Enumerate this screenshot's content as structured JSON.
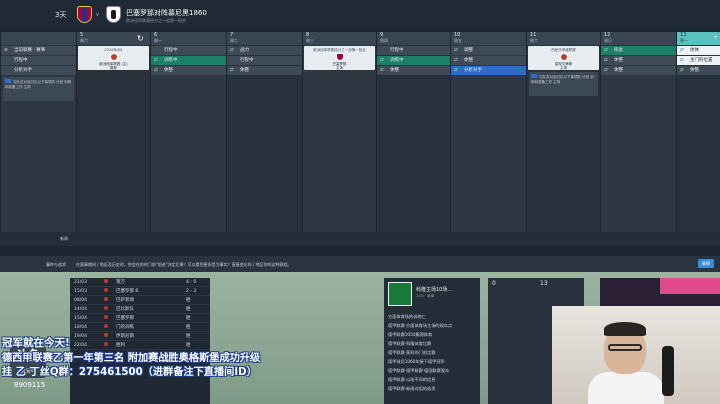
{
  "header": {
    "days": "3天",
    "vs": "v",
    "match_title": "巴塞罗那对阵慕尼黑1860",
    "match_sub": "欧洲冠军联赛经分之一战第一回合"
  },
  "calendar": {
    "columns": [
      {
        "day": "",
        "weekday": "",
        "rows": [
          {
            "icon": "⊕",
            "text": "当前联赛 · 赛事",
            "style": "plain"
          },
          {
            "icon": "",
            "text": "行程中",
            "style": "plain"
          },
          {
            "icon": "",
            "text": "分析对手",
            "style": "plain"
          }
        ],
        "note": "与队友对话讨论以下事项的 计划 训练和准备工作 主场"
      },
      {
        "day": "5",
        "weekday": "周六",
        "card": {
          "top": "2026年4月",
          "name": "欧洲冠军联赛 (主)",
          "sub": "赛前",
          "badge": "red"
        },
        "rows": []
      },
      {
        "day": "6",
        "weekday": "周一",
        "rows": [
          {
            "icon": "",
            "text": "行程中",
            "style": "plain"
          },
          {
            "icon": "⇄",
            "text": "训练中",
            "style": "green"
          },
          {
            "icon": "⇄",
            "text": "休整",
            "style": "plain"
          }
        ]
      },
      {
        "day": "7",
        "weekday": "周二",
        "rows": [
          {
            "icon": "⇄",
            "text": "战力",
            "style": "plain"
          },
          {
            "icon": "",
            "text": "行程中",
            "style": "plain"
          },
          {
            "icon": "⇄",
            "text": "休整",
            "style": "plain"
          }
        ]
      },
      {
        "day": "8",
        "weekday": "周三",
        "card": {
          "top": "欧洲冠军联赛经分之一战第一回合",
          "name": "巴塞罗那",
          "sub": "主场",
          "badge": "alt"
        },
        "rows": []
      },
      {
        "day": "9",
        "weekday": "周四",
        "rows": [
          {
            "icon": "",
            "text": "行程中",
            "style": "plain"
          },
          {
            "icon": "⇄",
            "text": "训练中",
            "style": "green"
          },
          {
            "icon": "⇄",
            "text": "休整",
            "style": "plain"
          }
        ]
      },
      {
        "day": "10",
        "weekday": "周五",
        "rows": [
          {
            "icon": "⇄",
            "text": "调整",
            "style": "plain"
          },
          {
            "icon": "⇄",
            "text": "休整",
            "style": "plain"
          },
          {
            "icon": "⇄",
            "text": "分析对手",
            "style": "blue"
          }
        ]
      },
      {
        "day": "11",
        "weekday": "周六",
        "card": {
          "top": "西班牙甲级联赛",
          "name": "皇家贝蒂斯",
          "sub": "主场",
          "badge": "red"
        },
        "rows": [],
        "note": "与队友对话讨论以下事项的 计划 训练和准备工作 主场"
      },
      {
        "day": "12",
        "weekday": "周日",
        "rows": [
          {
            "icon": "⇄",
            "text": "恢复",
            "style": "green"
          },
          {
            "icon": "⇄",
            "text": "休整",
            "style": "plain"
          },
          {
            "icon": "⇄",
            "text": "休整",
            "style": "plain"
          }
        ]
      },
      {
        "day": "13",
        "weekday": "周一",
        "today": true,
        "rows": [
          {
            "icon": "⇄",
            "text": "体休",
            "style": "white"
          },
          {
            "icon": "⇄",
            "text": "主门的位置",
            "style": "white"
          },
          {
            "icon": "⇄",
            "text": "休整",
            "style": "plain"
          }
        ]
      }
    ]
  },
  "strip_label": "新闻",
  "desc": {
    "label": "事件与战术",
    "text": "在赛事期间 / 地区及历史时，你会在你的门前\"前进\"决定后果？可以看到更多是为事实？直接变化的 / 地区你的这种赛程。",
    "button": "解释"
  },
  "fixtures": [
    {
      "date": "21/03",
      "opp": "莱万",
      "res": "4 - 0"
    },
    {
      "date": "15/03",
      "opp": "巴塞罗那 B",
      "res": "2 - 3"
    },
    {
      "date": "08/04",
      "opp": "巴萨新闻",
      "res": "胜"
    },
    {
      "date": "14/04",
      "opp": "巴比斯队",
      "res": "胜"
    },
    {
      "date": "15/04",
      "opp": "巴塞罗那",
      "res": "胜"
    },
    {
      "date": "18/04",
      "opp": "门的训练",
      "res": "胜"
    },
    {
      "date": "19/04",
      "opp": "伊斯尼斯",
      "res": "胜"
    },
    {
      "date": "22/04",
      "opp": "胜利",
      "res": "胜"
    }
  ],
  "news": {
    "headline": "科隆主场10场…",
    "sub": "1.05 · 新闻",
    "items": [
      "方面体育场的训练仁",
      "德甲联赛·方面体育场主场的观众点",
      "德甲联赛1050集锦体育",
      "德甲联赛·科隆体育比赛",
      "德甲联赛·莫科的门前比赛",
      "德甲球员1060年接下德甲冠军",
      "德甲联赛·德甲联赛·德国联赛观众",
      "德甲联赛·以前不同的信息",
      "德甲联赛·新闻对组的选项"
    ]
  },
  "mid_panel": {
    "n1": "0",
    "n2": "13"
  },
  "overlay": {
    "line1": "冠军就在今天!",
    "line2": "德西甲联赛乙第一年第三名 附加赛战胜奥格斯堡成功升级",
    "line3": "挂 乙 丁丝Q群：275461500（进群备注下直播间ID）",
    "logo": "斗鱼",
    "logo_sub": "房间号",
    "room_id": "8909115"
  }
}
